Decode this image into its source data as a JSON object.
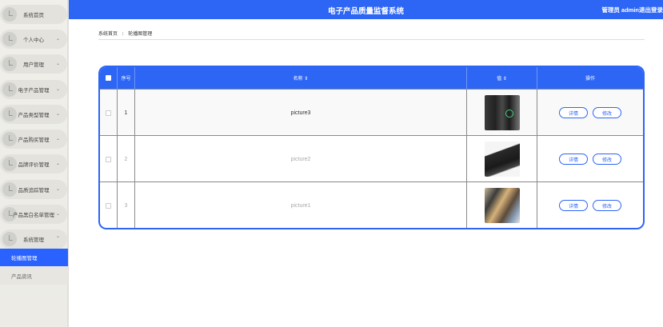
{
  "header": {
    "title": "电子产品质量监督系统",
    "user": "管理员 admin",
    "logout": "退出登录"
  },
  "sidebar": {
    "items": [
      {
        "label": "系统首页",
        "has_arrow": false
      },
      {
        "label": "个人中心",
        "has_arrow": true
      },
      {
        "label": "用户管理",
        "has_arrow": true
      },
      {
        "label": "电子产品管理",
        "has_arrow": true
      },
      {
        "label": "产品类型管理",
        "has_arrow": true
      },
      {
        "label": "产品购买管理",
        "has_arrow": true
      },
      {
        "label": "品牌评价管理",
        "has_arrow": true
      },
      {
        "label": "品质追踪管理",
        "has_arrow": true
      },
      {
        "label": "产品黑白名单管理",
        "has_arrow": true
      },
      {
        "label": "系统管理",
        "has_arrow": true
      }
    ],
    "sub_items": [
      {
        "label": "轮播图管理",
        "active": true
      },
      {
        "label": "产品资讯",
        "active": false
      }
    ]
  },
  "breadcrumb": {
    "home": "系统首页",
    "current": "轮播图管理"
  },
  "table": {
    "headers": {
      "index": "序号",
      "name": "名称 ⇕",
      "value": "值 ⇕",
      "actions": "操作"
    },
    "rows": [
      {
        "index": "1",
        "name": "picture3",
        "thumb": "t1"
      },
      {
        "index": "2",
        "name": "picture2",
        "thumb": "t2"
      },
      {
        "index": "3",
        "name": "picture1",
        "thumb": "t3"
      }
    ],
    "detail_label": "详情",
    "edit_label": "修改"
  },
  "colors": {
    "accent": "#2d66f5"
  }
}
